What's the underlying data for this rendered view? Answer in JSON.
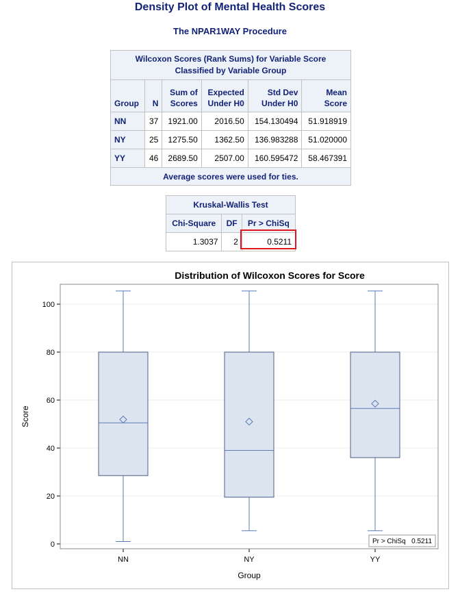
{
  "page_title": "Density Plot of Mental Health Scores",
  "proc_title": "The NPAR1WAY Procedure",
  "wilcoxon_table": {
    "caption_line1": "Wilcoxon Scores (Rank Sums) for Variable Score",
    "caption_line2": "Classified by Variable Group",
    "headers": [
      [
        "Group"
      ],
      [
        "N"
      ],
      [
        "Sum of",
        "Scores"
      ],
      [
        "Expected",
        "Under H0"
      ],
      [
        "Std Dev",
        "Under H0"
      ],
      [
        "Mean",
        "Score"
      ]
    ],
    "rows": [
      {
        "group": "NN",
        "n": "37",
        "sum": "1921.00",
        "expected": "2016.50",
        "std": "154.130494",
        "mean": "51.918919"
      },
      {
        "group": "NY",
        "n": "25",
        "sum": "1275.50",
        "expected": "1362.50",
        "std": "136.983288",
        "mean": "51.020000"
      },
      {
        "group": "YY",
        "n": "46",
        "sum": "2689.50",
        "expected": "2507.00",
        "std": "160.595472",
        "mean": "58.467391"
      }
    ],
    "footnote": "Average scores were used for ties."
  },
  "kruskal_table": {
    "caption": "Kruskal-Wallis Test",
    "headers": [
      "Chi-Square",
      "DF",
      "Pr > ChiSq"
    ],
    "values": [
      "1.3037",
      "2",
      "0.5211"
    ]
  },
  "colors": {
    "title_text": "#112277",
    "header_bg": "#edf2f9",
    "box_fill": "#dce4ef",
    "box_stroke": "#4b5d86",
    "whisker": "#5a7ab8",
    "highlight": "#e0151d"
  },
  "chart_data": {
    "type": "box",
    "title": "Distribution of Wilcoxon Scores for Score",
    "xlabel": "Group",
    "ylabel": "Score",
    "ylim": [
      0,
      105.5
    ],
    "yticks": [
      0,
      20,
      40,
      60,
      80,
      100
    ],
    "grid": true,
    "categories": [
      "NN",
      "NY",
      "YY"
    ],
    "boxes": [
      {
        "name": "NN",
        "min": 1,
        "q1": 28.5,
        "median": 50.5,
        "q3": 80,
        "max": 105.5,
        "mean": 51.9
      },
      {
        "name": "NY",
        "min": 5.5,
        "q1": 19.5,
        "median": 39,
        "q3": 80,
        "max": 105.5,
        "mean": 51.0
      },
      {
        "name": "YY",
        "min": 5.5,
        "q1": 36,
        "median": 56.5,
        "q3": 80,
        "max": 105.5,
        "mean": 58.5
      }
    ],
    "inset": {
      "label": "Pr > ChiSq",
      "value": "0.5211",
      "position": "bottom-right"
    }
  }
}
